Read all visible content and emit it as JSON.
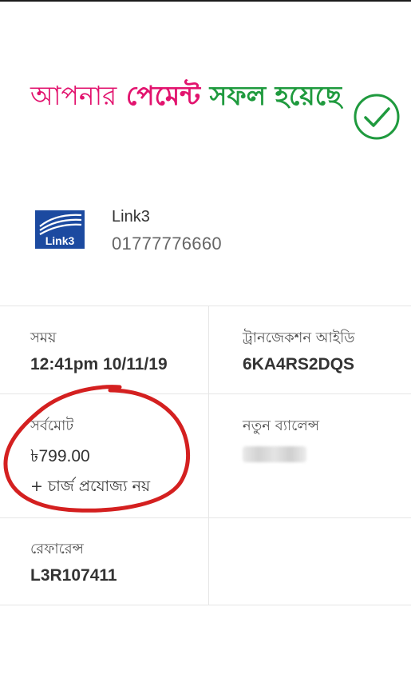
{
  "header": {
    "title_part1": "আপনার",
    "title_part2": "পেমেন্ট",
    "title_part3": "সফল",
    "title_part4": "হয়েছে"
  },
  "merchant": {
    "logo_text": "Link3",
    "name": "Link3",
    "number": "01777776660"
  },
  "details": {
    "time_label": "সময়",
    "time_value": "12:41pm 10/11/19",
    "trxid_label": "ট্রানজেকশন আইডি",
    "trxid_value": "6KA4RS2DQS",
    "total_label": "সর্বমোট",
    "total_value": "৳799.00",
    "charge_note": "+ চার্জ প্রযোজ্য নয়",
    "balance_label": "নতুন ব্যালেন্স",
    "reference_label": "রেফারেন্স",
    "reference_value": "L3R107411"
  },
  "colors": {
    "brand_pink": "#e2136e",
    "success_green": "#1f9a3e",
    "annotation_red": "#d42020",
    "link3_blue": "#1c4aa0"
  },
  "icons": {
    "success": "check-circle-icon",
    "merchant": "link3-logo"
  }
}
